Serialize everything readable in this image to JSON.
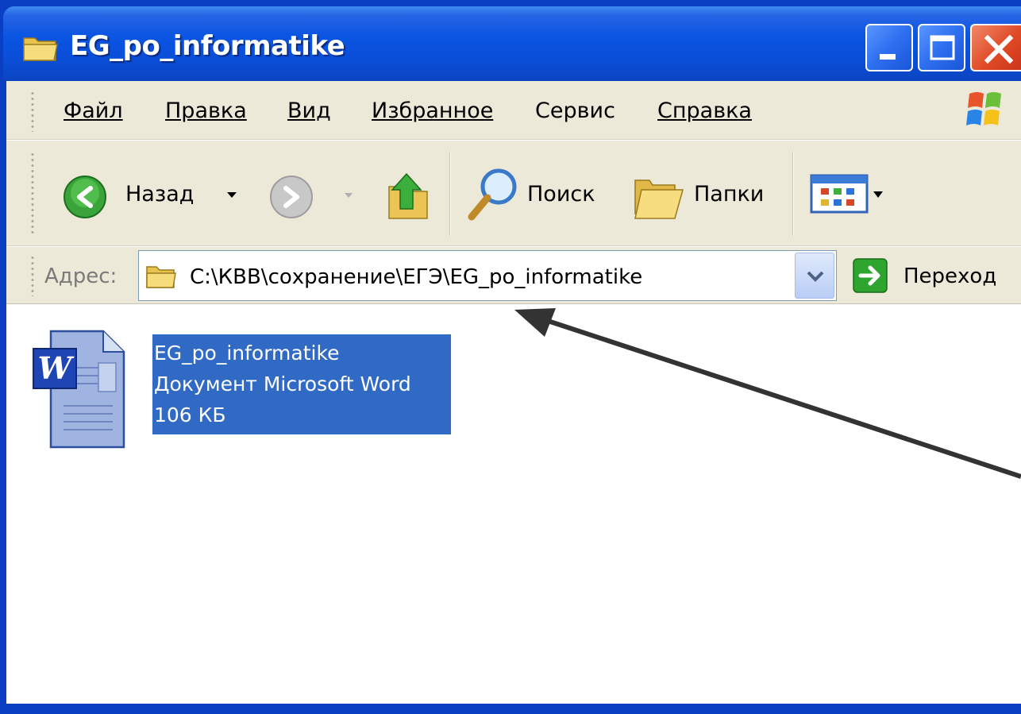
{
  "window": {
    "title": "EG_po_informatike",
    "controls": {
      "minimize": "minimize",
      "maximize": "maximize",
      "close": "close"
    }
  },
  "menubar": {
    "items": [
      {
        "label": "Файл",
        "hotkey_index": 0
      },
      {
        "label": "Правка",
        "hotkey_index": 0
      },
      {
        "label": "Вид",
        "hotkey_index": 0
      },
      {
        "label": "Избранное",
        "hotkey_index": 0
      },
      {
        "label": "Сервис",
        "hotkey_index": 1
      },
      {
        "label": "Справка",
        "hotkey_index": 0
      }
    ]
  },
  "toolbar": {
    "back_label": "Назад",
    "search_label": "Поиск",
    "folders_label": "Папки"
  },
  "address": {
    "label": "Адрес:",
    "value": "C:\\КВВ\\сохранение\\ЕГЭ\\EG_po_informatike",
    "go_label": "Переход"
  },
  "files": [
    {
      "name": "EG_po_informatike",
      "type": "Документ Microsoft Word",
      "size": "106 КБ",
      "icon": "word-document-icon",
      "selected": true
    }
  ],
  "colors": {
    "titlebar": "#0a55e2",
    "selection": "#316ac5",
    "toolbar_bg": "#ece9d8",
    "close_button": "#e04a25"
  }
}
